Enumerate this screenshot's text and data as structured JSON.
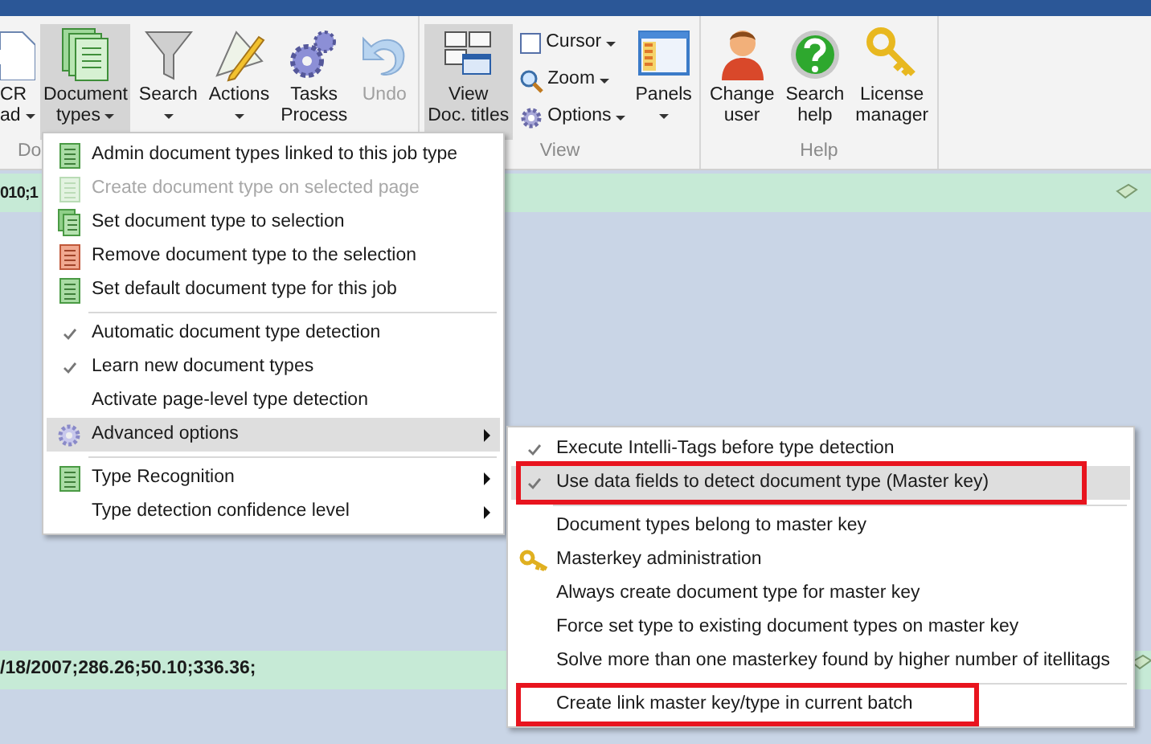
{
  "ribbon": {
    "groups": [
      {
        "label": "Do",
        "buttons": [
          {
            "kind": "large",
            "lines": [
              "CR",
              "ad"
            ],
            "dropdown": true,
            "selected": false,
            "disabled": false
          },
          {
            "kind": "large",
            "lines": [
              "Document",
              "types"
            ],
            "dropdown": true,
            "selected": true,
            "disabled": false
          },
          {
            "kind": "large",
            "lines": [
              "Search"
            ],
            "dropdown": true,
            "selected": false,
            "disabled": false
          },
          {
            "kind": "large",
            "lines": [
              "Actions"
            ],
            "dropdown": true,
            "selected": false,
            "disabled": false
          },
          {
            "kind": "large",
            "lines": [
              "Tasks",
              "Process"
            ],
            "dropdown": false,
            "selected": false,
            "disabled": false
          },
          {
            "kind": "large",
            "lines": [
              "Undo"
            ],
            "dropdown": false,
            "selected": false,
            "disabled": true
          }
        ]
      },
      {
        "label": "View",
        "buttons": [
          {
            "kind": "large",
            "lines": [
              "View",
              "Doc. titles"
            ],
            "dropdown": false,
            "selected": true,
            "disabled": false
          },
          {
            "kind": "small",
            "lines": [
              "Cursor"
            ],
            "dropdown": true,
            "selected": false,
            "disabled": false
          },
          {
            "kind": "small",
            "lines": [
              "Zoom"
            ],
            "dropdown": true,
            "selected": false,
            "disabled": false
          },
          {
            "kind": "small",
            "lines": [
              "Options"
            ],
            "dropdown": true,
            "selected": false,
            "disabled": false
          },
          {
            "kind": "large",
            "lines": [
              "Panels"
            ],
            "dropdown": true,
            "selected": false,
            "disabled": false
          }
        ]
      },
      {
        "label": "Help",
        "buttons": [
          {
            "kind": "large",
            "lines": [
              "Change",
              "user"
            ],
            "dropdown": false,
            "selected": false,
            "disabled": false
          },
          {
            "kind": "large",
            "lines": [
              "Search",
              "help"
            ],
            "dropdown": false,
            "selected": false,
            "disabled": false
          },
          {
            "kind": "large",
            "lines": [
              "License",
              "manager"
            ],
            "dropdown": false,
            "selected": false,
            "disabled": false
          }
        ]
      }
    ]
  },
  "rows": [
    {
      "text": "010;1"
    },
    {
      "text": "/18/2007;286.26;50.10;336.36;"
    }
  ],
  "menu": {
    "items": [
      {
        "kind": "item",
        "label": "Admin document types linked to this job type",
        "disabled": false,
        "checked": false,
        "highlighted": false,
        "submenu": false,
        "annotated": false
      },
      {
        "kind": "item",
        "label": "Create document type on selected page",
        "disabled": true,
        "checked": false,
        "highlighted": false,
        "submenu": false,
        "annotated": false
      },
      {
        "kind": "item",
        "label": "Set document type to selection",
        "disabled": false,
        "checked": false,
        "highlighted": false,
        "submenu": false,
        "annotated": false
      },
      {
        "kind": "item",
        "label": "Remove document type to the selection",
        "disabled": false,
        "checked": false,
        "highlighted": false,
        "submenu": false,
        "annotated": false
      },
      {
        "kind": "item",
        "label": "Set default document type for this job",
        "disabled": false,
        "checked": false,
        "highlighted": false,
        "submenu": false,
        "annotated": false
      },
      {
        "kind": "separator"
      },
      {
        "kind": "item",
        "label": "Automatic document type detection",
        "disabled": false,
        "checked": true,
        "highlighted": false,
        "submenu": false,
        "annotated": false
      },
      {
        "kind": "item",
        "label": "Learn new document types",
        "disabled": false,
        "checked": true,
        "highlighted": false,
        "submenu": false,
        "annotated": false
      },
      {
        "kind": "item",
        "label": "Activate page-level type detection",
        "disabled": false,
        "checked": false,
        "highlighted": false,
        "submenu": false,
        "annotated": false
      },
      {
        "kind": "item",
        "label": "Advanced options",
        "disabled": false,
        "checked": false,
        "highlighted": true,
        "submenu": true,
        "annotated": false
      },
      {
        "kind": "separator"
      },
      {
        "kind": "item",
        "label": "Type Recognition",
        "disabled": false,
        "checked": false,
        "highlighted": false,
        "submenu": true,
        "annotated": false
      },
      {
        "kind": "item",
        "label": "Type detection confidence level",
        "disabled": false,
        "checked": false,
        "highlighted": false,
        "submenu": true,
        "annotated": false
      }
    ]
  },
  "submenu": {
    "items": [
      {
        "kind": "item",
        "label": "Execute Intelli-Tags before type detection",
        "disabled": false,
        "checked": true,
        "highlighted": false,
        "submenu": false,
        "annotated": false
      },
      {
        "kind": "item",
        "label": "Use data fields to detect document type (Master key)",
        "disabled": false,
        "checked": true,
        "highlighted": true,
        "submenu": false,
        "annotated": true
      },
      {
        "kind": "separator"
      },
      {
        "kind": "item",
        "label": "Document types belong to master key",
        "disabled": false,
        "checked": false,
        "highlighted": false,
        "submenu": false,
        "annotated": false
      },
      {
        "kind": "item",
        "label": "Masterkey administration",
        "disabled": false,
        "checked": false,
        "highlighted": false,
        "submenu": false,
        "annotated": false
      },
      {
        "kind": "item",
        "label": "Always create document type for master key",
        "disabled": false,
        "checked": false,
        "highlighted": false,
        "submenu": false,
        "annotated": false
      },
      {
        "kind": "item",
        "label": "Force set type to existing document types on master key",
        "disabled": false,
        "checked": false,
        "highlighted": false,
        "submenu": false,
        "annotated": false
      },
      {
        "kind": "item",
        "label": "Solve more than one masterkey found by higher number of itellitags",
        "disabled": false,
        "checked": false,
        "highlighted": false,
        "submenu": false,
        "annotated": false
      },
      {
        "kind": "separator"
      },
      {
        "kind": "item",
        "label": "Create link master key/type in current batch",
        "disabled": false,
        "checked": false,
        "highlighted": false,
        "submenu": false,
        "annotated": true
      }
    ]
  }
}
